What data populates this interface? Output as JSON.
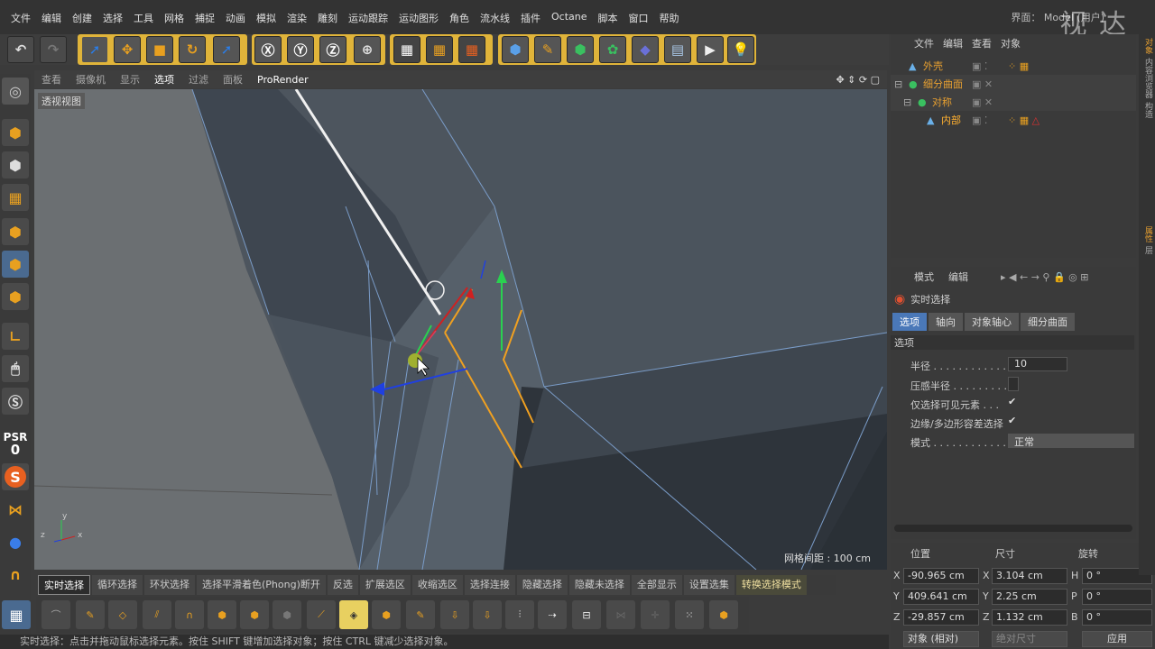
{
  "menu": [
    "文件",
    "编辑",
    "创建",
    "选择",
    "工具",
    "网格",
    "捕捉",
    "动画",
    "模拟",
    "渲染",
    "雕刻",
    "运动跟踪",
    "运动图形",
    "角色",
    "流水线",
    "插件",
    "Octane",
    "脚本",
    "窗口",
    "帮助"
  ],
  "layout_label": "界面：",
  "layout_value": "Model (用户)",
  "watermark": "视 达",
  "viewport_menu": [
    "查看",
    "摄像机",
    "显示",
    "选项",
    "过滤",
    "面板",
    "ProRender"
  ],
  "viewport_title": "透视视图",
  "grid_spacing": "网格间距 : 100 cm",
  "axis_labels": {
    "y": "y",
    "z": "z",
    "x": "x"
  },
  "psr_label": "PSR",
  "psr_value": "0",
  "mode_buttons": [
    "实时选择",
    "循环选择",
    "环状选择",
    "选择平滑着色(Phong)断开",
    "反选",
    "扩展选区",
    "收缩选区",
    "选择连接",
    "隐藏选择",
    "隐藏未选择",
    "全部显示",
    "设置选集",
    "转换选择模式"
  ],
  "status_text": "实时选择：点击并拖动鼠标选择元素。按住 SHIFT 键增加选择对象；按住 CTRL 键减少选择对象。",
  "object_manager": {
    "menu": [
      "文件",
      "编辑",
      "查看",
      "对象"
    ],
    "objects": [
      {
        "name": "外壳",
        "color": "#e8a030"
      },
      {
        "name": "细分曲面",
        "color": "#e8a030"
      },
      {
        "name": "对称",
        "color": "#e8a030"
      },
      {
        "name": "内部",
        "color": "#ffb030"
      }
    ]
  },
  "attributes": {
    "menu": [
      "模式",
      "编辑"
    ],
    "tool_name": "实时选择",
    "tabs": [
      "选项",
      "轴向",
      "对象轴心",
      "细分曲面"
    ],
    "section": "选项",
    "rows": [
      {
        "label": "半径 . . . . . . . . . . . . . .",
        "value": "10"
      },
      {
        "label": "压感半径 . . . . . . . . .",
        "value": ""
      },
      {
        "label": "仅选择可见元素 . . .",
        "value": "✔"
      },
      {
        "label": "边缘/多边形容差选择",
        "value": "✔"
      },
      {
        "label": "模式 . . . . . . . . . . . . . .",
        "value": "正常"
      }
    ]
  },
  "coordinates": {
    "headers": [
      "位置",
      "尺寸",
      "旋转"
    ],
    "position": [
      {
        "axis": "X",
        "value": "-90.965 cm"
      },
      {
        "axis": "Y",
        "value": "409.641 cm"
      },
      {
        "axis": "Z",
        "value": "-29.857 cm"
      }
    ],
    "size": [
      {
        "axis": "X",
        "value": "3.104 cm"
      },
      {
        "axis": "Y",
        "value": "2.25 cm"
      },
      {
        "axis": "Z",
        "value": "1.132 cm"
      }
    ],
    "rotation": [
      {
        "axis": "H",
        "value": "0 °"
      },
      {
        "axis": "P",
        "value": "0 °"
      },
      {
        "axis": "B",
        "value": "0 °"
      }
    ],
    "coord_mode": "对象 (相对)",
    "size_mode": "绝对尺寸",
    "apply": "应用"
  },
  "right_tabs": [
    "对象",
    "内容浏览器",
    "构造",
    "属性",
    "层"
  ],
  "colors": {
    "accent": "#e8a030",
    "viewport": "#4d555e",
    "selected_edge": "#f0a020"
  }
}
